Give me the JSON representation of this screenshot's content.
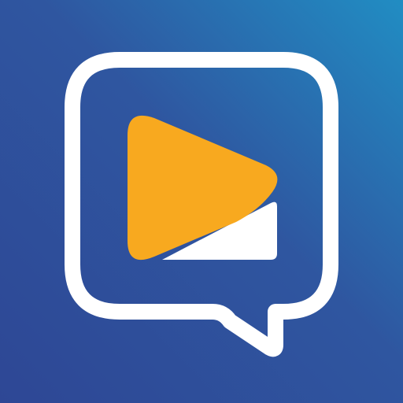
{
  "icon": {
    "name": "video-chat-app-icon",
    "elements": [
      "speech-bubble-icon",
      "play-icon",
      "page-fold-icon"
    ]
  },
  "colors": {
    "background_start": "#2e4795",
    "background_mid": "#2f56a0",
    "background_end": "#218dc3",
    "bubble_outline": "#ffffff",
    "play": "#f8a91f",
    "fold": "#ffffff"
  }
}
